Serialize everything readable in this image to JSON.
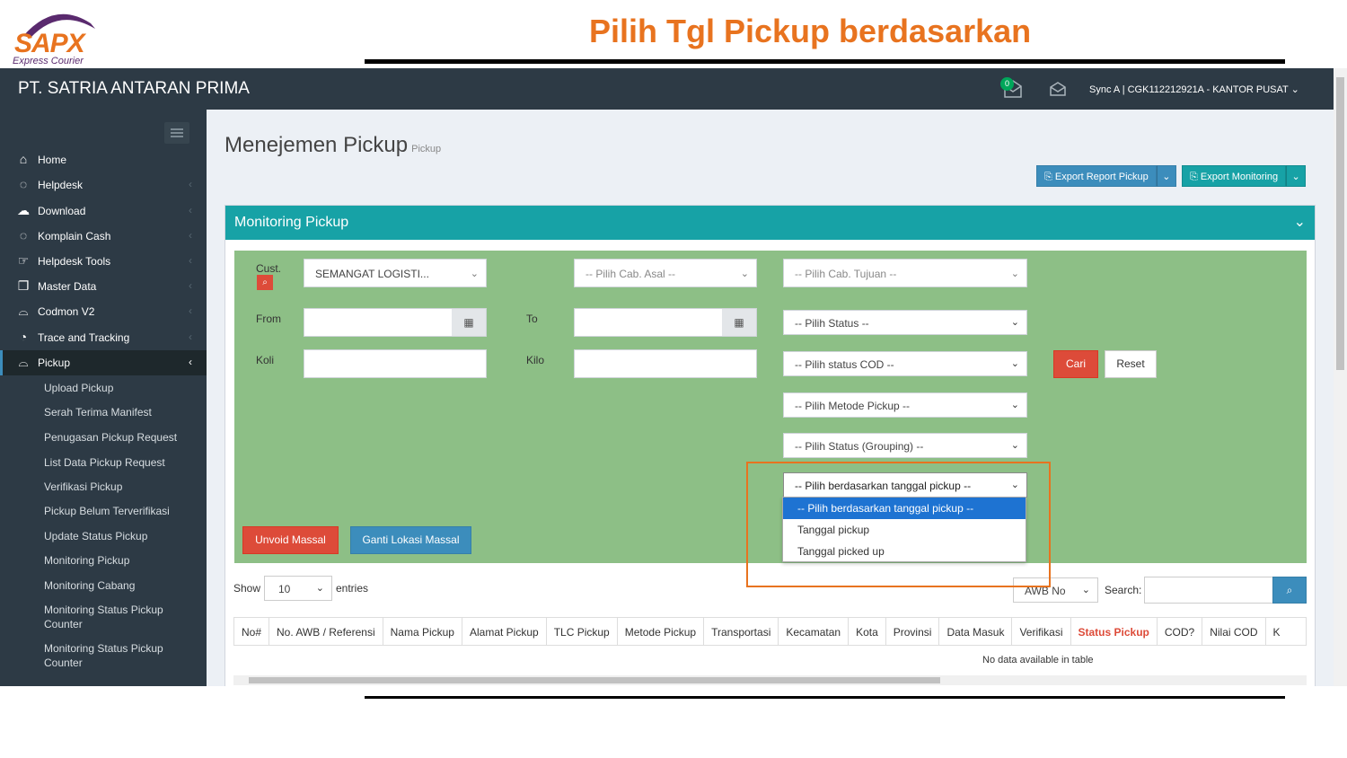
{
  "slide": {
    "logo_text": "SAPX",
    "logo_sub": "Express Courier",
    "title": "Pilih Tgl Pickup berdasarkan"
  },
  "topbar": {
    "company": "PT. SATRIA ANTARAN PRIMA",
    "notif_count": "0",
    "user": "Sync A | CGK112212921A - KANTOR PUSAT ⌄"
  },
  "sidebar": {
    "items": [
      {
        "label": "Home",
        "icon": "home-icon"
      },
      {
        "label": "Helpdesk",
        "icon": "chat-icon"
      },
      {
        "label": "Download",
        "icon": "cloud-download-icon"
      },
      {
        "label": "Komplain Cash",
        "icon": "chat-icon"
      },
      {
        "label": "Helpdesk Tools",
        "icon": "hand-icon"
      },
      {
        "label": "Master Data",
        "icon": "file-icon"
      },
      {
        "label": "Codmon V2",
        "icon": "bag-icon"
      },
      {
        "label": "Trace and Tracking",
        "icon": "rss-icon"
      },
      {
        "label": "Pickup",
        "icon": "bag-icon"
      }
    ],
    "sub_items": [
      "Upload Pickup",
      "Serah Terima Manifest",
      "Penugasan Pickup Request",
      "List Data Pickup Request",
      "Verifikasi Pickup",
      "Pickup Belum Terverifikasi",
      "Update Status Pickup",
      "Monitoring Pickup",
      "Monitoring Cabang",
      "Monitoring Status Pickup Counter",
      "Monitoring Status Pickup Counter"
    ]
  },
  "page": {
    "title": "Menejemen Pickup",
    "subtitle": "Pickup",
    "export_report": "Export Report Pickup",
    "export_monitoring": "Export Monitoring"
  },
  "panel": {
    "title": "Monitoring Pickup"
  },
  "filter": {
    "cust_label": "Cust.",
    "cust_value": "SEMANGAT LOGISTI...",
    "cab_asal": "-- Pilih Cab. Asal --",
    "cab_tujuan": "-- Pilih Cab. Tujuan --",
    "from_label": "From",
    "to_label": "To",
    "status": "-- Pilih Status --",
    "koli_label": "Koli",
    "kilo_label": "Kilo",
    "status_cod": "-- Pilih status COD --",
    "cari": "Cari",
    "reset": "Reset",
    "metode": "-- Pilih Metode Pickup --",
    "status_grouping": "-- Pilih Status (Grouping) --",
    "tanggal": "-- Pilih berdasarkan tanggal pickup --",
    "tanggal_options": [
      "-- Pilih berdasarkan tanggal pickup --",
      "Tanggal pickup",
      "Tanggal picked up"
    ],
    "unvoid": "Unvoid Massal",
    "ganti_lokasi": "Ganti Lokasi Massal"
  },
  "table": {
    "show_label": "Show",
    "show_value": "10",
    "entries_label": "entries",
    "search_by": "AWB No",
    "search_label": "Search:",
    "columns": [
      "No#",
      "No. AWB / Referensi",
      "Nama Pickup",
      "Alamat Pickup",
      "TLC Pickup",
      "Metode Pickup",
      "Transportasi",
      "Kecamatan",
      "Kota",
      "Provinsi",
      "Data Masuk",
      "Verifikasi",
      "Status Pickup",
      "COD?",
      "Nilai COD",
      "K"
    ],
    "empty": "No data available in table"
  },
  "colors": {
    "accent_orange": "#e8731f",
    "topbar": "#2d3a45",
    "teal": "#17a2a6",
    "filter_bg": "#8dbf86",
    "danger": "#dd4b39",
    "primary": "#3c8dbc"
  }
}
